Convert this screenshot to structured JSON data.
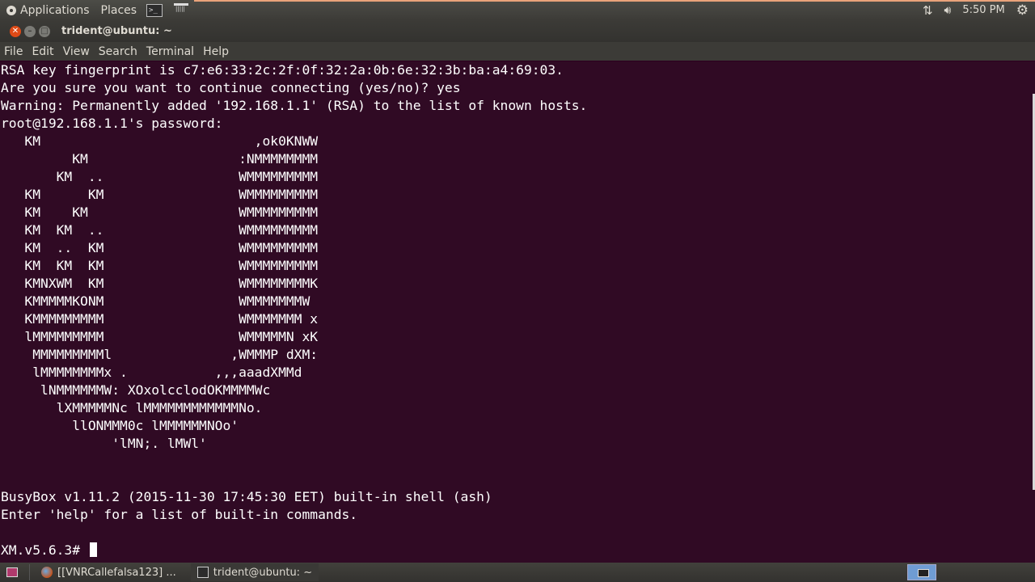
{
  "top_panel": {
    "applications": "Applications",
    "places": "Places",
    "terminal_launcher_glyph": ">_",
    "clock": "5:50 PM",
    "icons": [
      "gear-icon",
      "terminal-icon",
      "document-icon",
      "network-icon",
      "volume-icon",
      "settings-gear-icon"
    ]
  },
  "window": {
    "title": "trident@ubuntu: ~",
    "menu": [
      "File",
      "Edit",
      "View",
      "Search",
      "Terminal",
      "Help"
    ]
  },
  "terminal": {
    "lines": [
      "RSA key fingerprint is c7:e6:33:2c:2f:0f:32:2a:0b:6e:32:3b:ba:a4:69:03.",
      "Are you sure you want to continue connecting (yes/no)? yes",
      "Warning: Permanently added '192.168.1.1' (RSA) to the list of known hosts.",
      "root@192.168.1.1's password:",
      "   KM                           ,ok0KNWW",
      "         KM                   :NMMMMMMMM",
      "       KM  ..                 WMMMMMMMMM",
      "   KM      KM                 WMMMMMMMMM",
      "   KM    KM                   WMMMMMMMMM",
      "   KM  KM  ..                 WMMMMMMMMM",
      "   KM  ..  KM                 WMMMMMMMMM",
      "   KM  KM  KM                 WMMMMMMMMM",
      "   KMNXWM  KM                 WMMMMMMMMK",
      "   KMMMMMKONM                 WMMMMMMMW",
      "   KMMMMMMMMM                 WMMMMMMM x",
      "   lMMMMMMMMM                 WMMMMMN xK",
      "    MMMMMMMMMl               ,WMMMP dXM:",
      "    lMMMMMMMMx .           ,,,aaadXMMd",
      "     lNMMMMMMW: XOxolcclodOKMMMMWc",
      "       lXMMMMMNc lMMMMMMMMMMMMNo.",
      "         llONMMM0c lMMMMMMNOo'",
      "              'lMN;. lMWl'",
      "",
      "",
      "BusyBox v1.11.2 (2015-11-30 17:45:30 EET) built-in shell (ash)",
      "Enter 'help' for a list of built-in commands.",
      ""
    ],
    "prompt": "XM.v5.6.3#",
    "colors": {
      "background": "#300a24",
      "foreground": "#ffffff"
    }
  },
  "bottom_panel": {
    "tasks": [
      {
        "label": "[[VNRCallefalsa123] ...",
        "icon": "firefox-icon"
      },
      {
        "label": "trident@ubuntu: ~",
        "icon": "terminal-icon"
      }
    ]
  }
}
